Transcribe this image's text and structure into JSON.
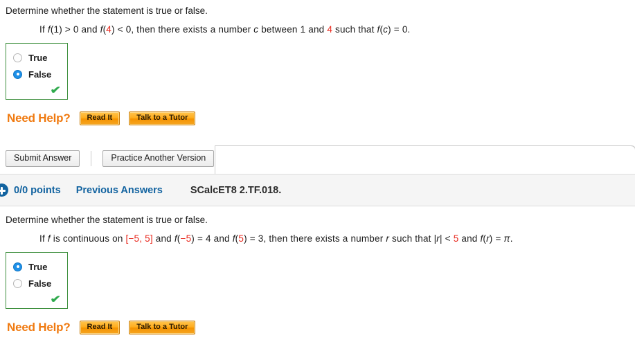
{
  "questions": [
    {
      "prompt": "Determine whether the statement is true or false.",
      "statement_parts": [
        {
          "t": "If ",
          "style": "plain"
        },
        {
          "t": "f",
          "style": "italic"
        },
        {
          "t": "(1) > 0 and ",
          "style": "plain"
        },
        {
          "t": "f",
          "style": "italic"
        },
        {
          "t": "(",
          "style": "plain"
        },
        {
          "t": "4",
          "style": "red"
        },
        {
          "t": ") < 0, then there exists a number ",
          "style": "plain"
        },
        {
          "t": "c",
          "style": "italic"
        },
        {
          "t": " between 1 and ",
          "style": "plain"
        },
        {
          "t": "4",
          "style": "red"
        },
        {
          "t": " such that ",
          "style": "plain"
        },
        {
          "t": "f",
          "style": "italic"
        },
        {
          "t": "(",
          "style": "plain"
        },
        {
          "t": "c",
          "style": "italic"
        },
        {
          "t": ") = 0.",
          "style": "plain"
        }
      ],
      "options": [
        {
          "label": "True",
          "selected": false
        },
        {
          "label": "False",
          "selected": true
        }
      ],
      "result_mark": "✔",
      "need_help_label": "Need Help?",
      "help_buttons": [
        "Read It",
        "Talk to a Tutor"
      ]
    },
    {
      "prompt": "Determine whether the statement is true or false.",
      "statement_parts": [
        {
          "t": "If ",
          "style": "plain"
        },
        {
          "t": "f",
          "style": "italic"
        },
        {
          "t": " is continuous on ",
          "style": "plain"
        },
        {
          "t": "[",
          "style": "red"
        },
        {
          "t": "−5",
          "style": "red"
        },
        {
          "t": ", ",
          "style": "red"
        },
        {
          "t": "5",
          "style": "red"
        },
        {
          "t": "]",
          "style": "red"
        },
        {
          "t": " and ",
          "style": "plain"
        },
        {
          "t": "f",
          "style": "italic"
        },
        {
          "t": "(",
          "style": "plain"
        },
        {
          "t": "−5",
          "style": "red"
        },
        {
          "t": ") = 4",
          "style": "plain"
        },
        {
          "t": " and ",
          "style": "plain"
        },
        {
          "t": "f",
          "style": "italic"
        },
        {
          "t": "(",
          "style": "plain"
        },
        {
          "t": "5",
          "style": "red"
        },
        {
          "t": ") = 3, then there exists a number ",
          "style": "plain"
        },
        {
          "t": "r",
          "style": "italic"
        },
        {
          "t": " such that |",
          "style": "plain"
        },
        {
          "t": "r",
          "style": "italic"
        },
        {
          "t": "| < ",
          "style": "plain"
        },
        {
          "t": "5",
          "style": "red"
        },
        {
          "t": " and ",
          "style": "plain"
        },
        {
          "t": "f",
          "style": "italic"
        },
        {
          "t": "(",
          "style": "plain"
        },
        {
          "t": "r",
          "style": "italic"
        },
        {
          "t": ") = ",
          "style": "plain"
        },
        {
          "t": "π",
          "style": "italic"
        },
        {
          "t": ".",
          "style": "plain"
        }
      ],
      "options": [
        {
          "label": "True",
          "selected": true
        },
        {
          "label": "False",
          "selected": false
        }
      ],
      "result_mark": "✔",
      "need_help_label": "Need Help?",
      "help_buttons": [
        "Read It",
        "Talk to a Tutor"
      ]
    }
  ],
  "submit_bar": {
    "submit_label": "Submit Answer",
    "practice_label": "Practice Another Version"
  },
  "points_band": {
    "points": "0/0 points",
    "previous_answers": "Previous Answers",
    "question_code": "SCalcET8 2.TF.018."
  },
  "colors": {
    "accent_blue": "#1263a0",
    "red": "#e8271c",
    "green_border": "#3d8f3d",
    "orange": "#f07a10",
    "check_green": "#2faa4d"
  }
}
